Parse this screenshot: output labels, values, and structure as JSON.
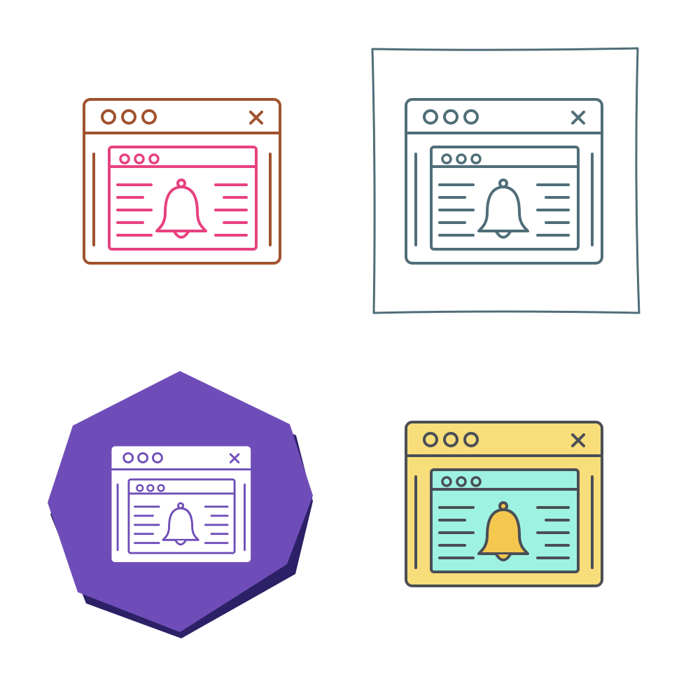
{
  "icon_set": {
    "subject": "browser-window-notification-bell",
    "variants": [
      {
        "key": "outline-colored",
        "icon": "browser-bell-icon",
        "outer_stroke": "#a0522d",
        "inner_stroke": "#e8417f",
        "outer_fill": "none",
        "inner_fill": "none",
        "bell_fill": "none",
        "background": "none"
      },
      {
        "key": "outline-framed",
        "icon": "browser-bell-icon",
        "outer_stroke": "#4f6e78",
        "inner_stroke": "#4f6e78",
        "outer_fill": "none",
        "inner_fill": "none",
        "bell_fill": "none",
        "background": "sketch-frame",
        "frame_stroke": "#4f6e78"
      },
      {
        "key": "glyph-octagon",
        "icon": "browser-bell-icon",
        "outer_stroke": "#6f4db8",
        "inner_stroke": "#6f4db8",
        "outer_fill": "#ffffff",
        "inner_fill": "#ffffff",
        "bell_fill": "#ffffff",
        "background": "octagon",
        "octagon_fill": "#6f4db8",
        "octagon_shadow": "#2c2166"
      },
      {
        "key": "filled",
        "icon": "browser-bell-icon",
        "outer_stroke": "#4a4e55",
        "inner_stroke": "#4a4e55",
        "outer_fill": "#f7de7a",
        "inner_fill": "#9ef2e0",
        "bell_fill": "#f4c84f",
        "background": "none"
      }
    ]
  }
}
